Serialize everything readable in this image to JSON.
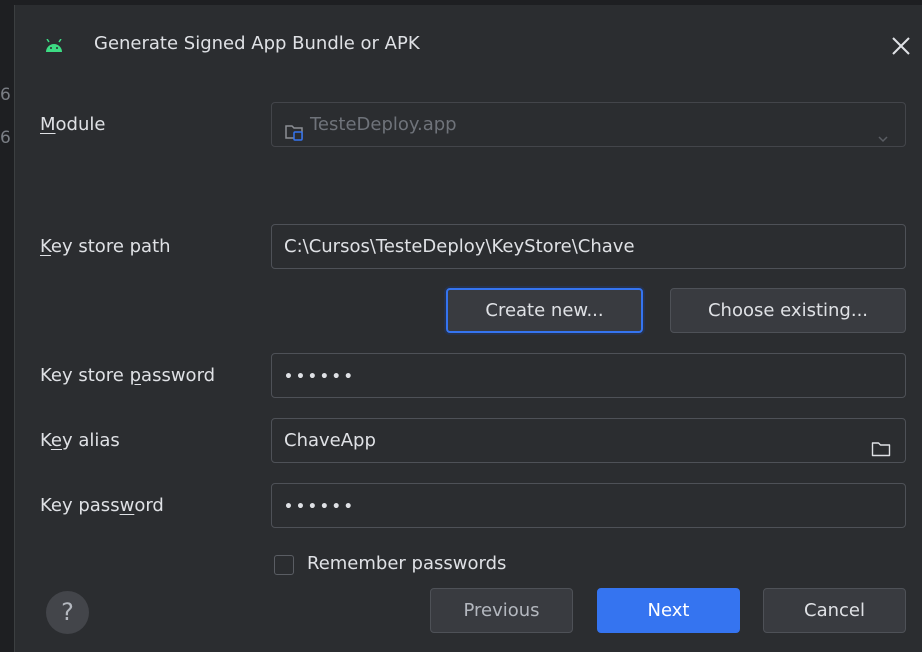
{
  "background": {
    "fragments": [
      "6",
      "6"
    ]
  },
  "dialog": {
    "title": "Generate Signed App Bundle or APK",
    "title_icon": "android-icon",
    "close_icon": "close-icon"
  },
  "module": {
    "label_mnemonic": "M",
    "label_rest": "odule",
    "value": "TesteDeploy.app",
    "icon": "module-folder-icon",
    "enabled": false
  },
  "key_store_path": {
    "label_mnemonic": "K",
    "label_rest": "ey store path",
    "value": "C:\\Cursos\\TesteDeploy\\KeyStore\\Chave"
  },
  "buttons": {
    "create_new": "Create new...",
    "choose_existing": "Choose existing...",
    "previous": "Previous",
    "next": "Next",
    "cancel": "Cancel",
    "help": "?"
  },
  "key_store_password": {
    "label_pre": "Key store ",
    "label_mnemonic": "p",
    "label_post": "assword",
    "value": "••••••"
  },
  "key_alias": {
    "label_pre": "K",
    "label_mnemonic": "e",
    "label_post": "y alias",
    "value": "ChaveApp"
  },
  "key_password": {
    "label_pre": "Key pass",
    "label_mnemonic": "w",
    "label_post": "ord",
    "value": "••••••"
  },
  "remember": {
    "label": "Remember passwords",
    "checked": false
  },
  "colors": {
    "accent": "#3574f0",
    "background": "#2b2d30",
    "border": "#4e5157",
    "android_green": "#3ddc84"
  }
}
